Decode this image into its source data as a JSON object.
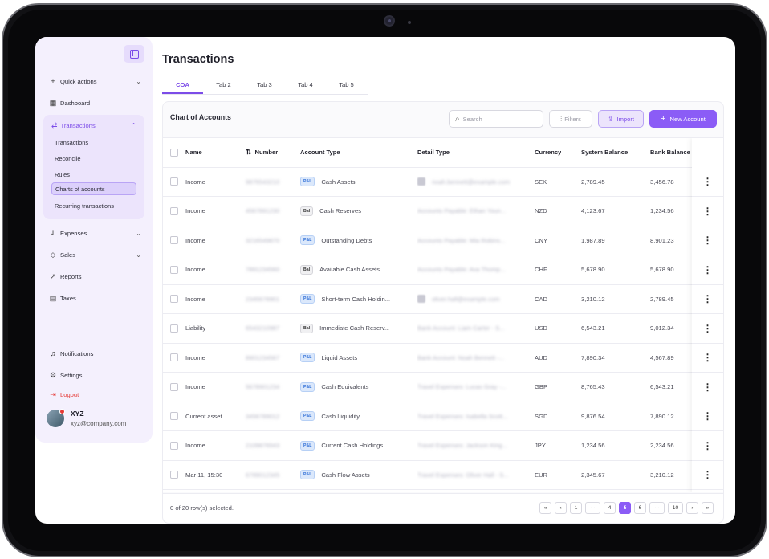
{
  "sidebar": {
    "quick_actions": "Quick actions",
    "dashboard": "Dashboard",
    "transactions": "Transactions",
    "sub_items": [
      "Transactions",
      "Reconcile",
      "Rules",
      "Charts of accounts",
      "Recurring transactions"
    ],
    "active_sub_item": "Charts of accounts",
    "expenses": "Expenses",
    "sales": "Sales",
    "reports": "Reports",
    "taxes": "Taxes",
    "notifications": "Notifications",
    "settings": "Settings",
    "logout": "Logout",
    "user": {
      "name": "XYZ",
      "email": "xyz@company.com"
    }
  },
  "page": {
    "title": "Transactions",
    "tabs": [
      "COA",
      "Tab 2",
      "Tab 3",
      "Tab 4",
      "Tab 5"
    ],
    "active_tab": "COA"
  },
  "card": {
    "title": "Chart of Accounts",
    "search_placeholder": "Search",
    "filters_label": "Filters",
    "import_label": "Import",
    "new_account_label": "New Account"
  },
  "table": {
    "columns": [
      "Name",
      "Number",
      "Account Type",
      "Detail Type",
      "Currency",
      "System Balance",
      "Bank Balance"
    ],
    "rows": [
      {
        "name": "Income",
        "number": "9876543210",
        "badge": "P&L",
        "type": "Cash Assets",
        "detail": "noah.bennett@example.com",
        "detail_img": true,
        "currency": "SEK",
        "system": "2,789.45",
        "bank": "3,456.78"
      },
      {
        "name": "Income",
        "number": "4567891230",
        "badge": "Bal",
        "type": "Cash Reserves",
        "detail": "Accounts Payable: Ethan Youn...",
        "detail_img": false,
        "currency": "NZD",
        "system": "4,123.67",
        "bank": "1,234.56"
      },
      {
        "name": "Income",
        "number": "3216549870",
        "badge": "P&L",
        "type": "Outstanding Debts",
        "detail": "Accounts Payable: Mia Robins...",
        "detail_img": false,
        "currency": "CNY",
        "system": "1,987.89",
        "bank": "8,901.23"
      },
      {
        "name": "Income",
        "number": "7891234560",
        "badge": "Bal",
        "type": "Available Cash Assets",
        "detail": "Accounts Payable: Ava Thomp...",
        "detail_img": false,
        "currency": "CHF",
        "system": "5,678.90",
        "bank": "5,678.90"
      },
      {
        "name": "Income",
        "number": "2345678901",
        "badge": "P&L",
        "type": "Short-term Cash Holdin...",
        "detail": "oliver.hall@example.com",
        "detail_img": true,
        "currency": "CAD",
        "system": "3,210.12",
        "bank": "2,789.45"
      },
      {
        "name": "Liability",
        "number": "6543210987",
        "badge": "Bal",
        "type": "Immediate Cash Reserv...",
        "detail": "Bank Account: Liam Carter - S...",
        "detail_img": false,
        "currency": "USD",
        "system": "6,543.21",
        "bank": "9,012.34"
      },
      {
        "name": "Income",
        "number": "8901234567",
        "badge": "P&L",
        "type": "Liquid Assets",
        "detail": "Bank Account: Noah Bennett -...",
        "detail_img": false,
        "currency": "AUD",
        "system": "7,890.34",
        "bank": "4,567.89"
      },
      {
        "name": "Income",
        "number": "5678901234",
        "badge": "P&L",
        "type": "Cash Equivalents",
        "detail": "Travel Expenses: Lucas Gray -...",
        "detail_img": false,
        "currency": "GBP",
        "system": "8,765.43",
        "bank": "6,543.21"
      },
      {
        "name": "Current asset",
        "number": "3456789012",
        "badge": "P&L",
        "type": "Cash Liquidity",
        "detail": "Travel Expenses: Isabella Scott...",
        "detail_img": false,
        "currency": "SGD",
        "system": "9,876.54",
        "bank": "7,890.12"
      },
      {
        "name": "Income",
        "number": "2109876543",
        "badge": "P&L",
        "type": "Current Cash Holdings",
        "detail": "Travel Expenses: Jackson King...",
        "detail_img": false,
        "currency": "JPY",
        "system": "1,234.56",
        "bank": "2,234.56"
      },
      {
        "name": "Mar 11, 15:30",
        "number": "6789012345",
        "badge": "P&L",
        "type": "Cash Flow Assets",
        "detail": "Travel Expenses: Oliver Hall - S...",
        "detail_img": false,
        "currency": "EUR",
        "system": "2,345.67",
        "bank": "3,210.12"
      }
    ]
  },
  "footer": {
    "selected_text": "0 of 20 row(s) selected.",
    "pages": [
      "«",
      "‹",
      "1",
      "···",
      "4",
      "5",
      "6",
      "···",
      "10",
      "›",
      "»"
    ],
    "active_page": "5"
  },
  "colors": {
    "accent": "#8b5cf6",
    "accent_light": "#ece4fc",
    "logout": "#e53935"
  }
}
